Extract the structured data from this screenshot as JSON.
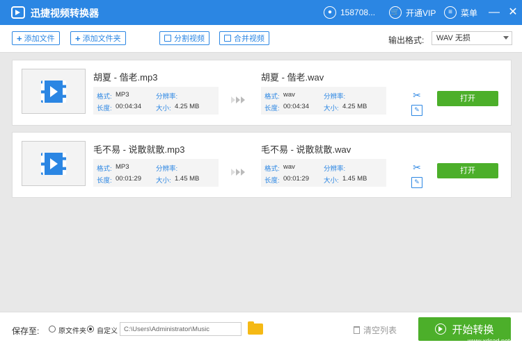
{
  "app": {
    "title": "迅捷视频转换器",
    "accent_color": "#2b86e3",
    "green_color": "#4caf2a"
  },
  "titlebar": {
    "user": {
      "icon": "user-icon",
      "label": "158708..."
    },
    "vip": {
      "icon": "cart-icon",
      "label": "开通VIP"
    },
    "menu": {
      "icon": "layers-icon",
      "label": "菜单"
    },
    "minimize": "—",
    "close": "✕"
  },
  "toolbar": {
    "add_file": "添加文件",
    "add_folder": "添加文件夹",
    "split_video": "分割视频",
    "merge_video": "合并视频",
    "output_format_label": "输出格式:",
    "output_format_value": "WAV 无损"
  },
  "files": [
    {
      "source_name": "胡夏 - 偕老.mp3",
      "target_name": "胡夏 - 偕老.wav",
      "source": {
        "format_label": "格式:",
        "format": "MP3",
        "resolution_label": "分辨率:",
        "resolution": "",
        "duration_label": "长度:",
        "duration": "00:04:34",
        "size_label": "大小:",
        "size": "4.25 MB"
      },
      "target": {
        "format_label": "格式:",
        "format": "wav",
        "resolution_label": "分辨率:",
        "resolution": "",
        "duration_label": "长度:",
        "duration": "00:04:34",
        "size_label": "大小:",
        "size": "4.25 MB"
      },
      "open_label": "打开"
    },
    {
      "source_name": "毛不易 - 说散就散.mp3",
      "target_name": "毛不易 - 说散就散.wav",
      "source": {
        "format_label": "格式:",
        "format": "MP3",
        "resolution_label": "分辨率:",
        "resolution": "",
        "duration_label": "长度:",
        "duration": "00:01:29",
        "size_label": "大小:",
        "size": "1.45 MB"
      },
      "target": {
        "format_label": "格式:",
        "format": "wav",
        "resolution_label": "分辨率:",
        "resolution": "",
        "duration_label": "长度:",
        "duration": "00:01:29",
        "size_label": "大小:",
        "size": "1.45 MB"
      },
      "open_label": "打开"
    }
  ],
  "bottom": {
    "save_to_label": "保存至:",
    "option_original": "原文件夹",
    "option_custom": "自定义",
    "selected_option": "custom",
    "path": "C:\\Users\\Administrator\\Music",
    "clear_list": "清空列表",
    "start_convert": "开始转换"
  },
  "watermark": "www.xdcad.net"
}
